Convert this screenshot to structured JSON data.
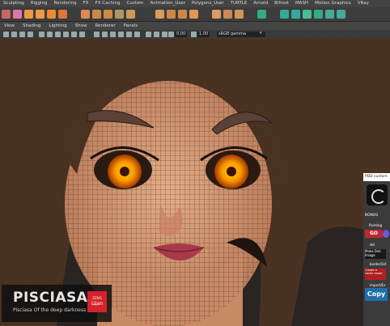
{
  "shelf_tabs": [
    "Sculpting",
    "Rigging",
    "Rendering",
    "FX",
    "FX Caching",
    "Custom",
    "Animation_User",
    "Polygons_User",
    "TURTLE",
    "Arnold",
    "Bifrost",
    "MASH",
    "Motion Graphics",
    "VRay"
  ],
  "panel_menu": [
    "View",
    "Shading",
    "Lighting",
    "Show",
    "Renderer",
    "Panels"
  ],
  "panel_toolbar": {
    "exposure_value": "0.00",
    "gamma_value": "1.00",
    "colorspace_label": "sRGB gamma"
  },
  "side_panel": {
    "title": "PDD custom",
    "bonus_label": "BONUS",
    "painting_label": "Painting",
    "go_label": "GO",
    "del_label": "del",
    "make_label": "Make Deli Image",
    "border_label": "borderOet",
    "note_label": "Create a cache mode",
    "import_label": "import/Ex",
    "copy_label": "Copy"
  },
  "watermark": {
    "brand": "PISCIASA",
    "tagline": "Pisciasa Of the deep darkness",
    "badge_line1": "ZZHG",
    "badge_line2": "Щan"
  },
  "colors": {
    "accent_red": "#d2242a",
    "eye_orange": "#ffa400",
    "skin": "#d29770",
    "hair": "#4a3222"
  }
}
